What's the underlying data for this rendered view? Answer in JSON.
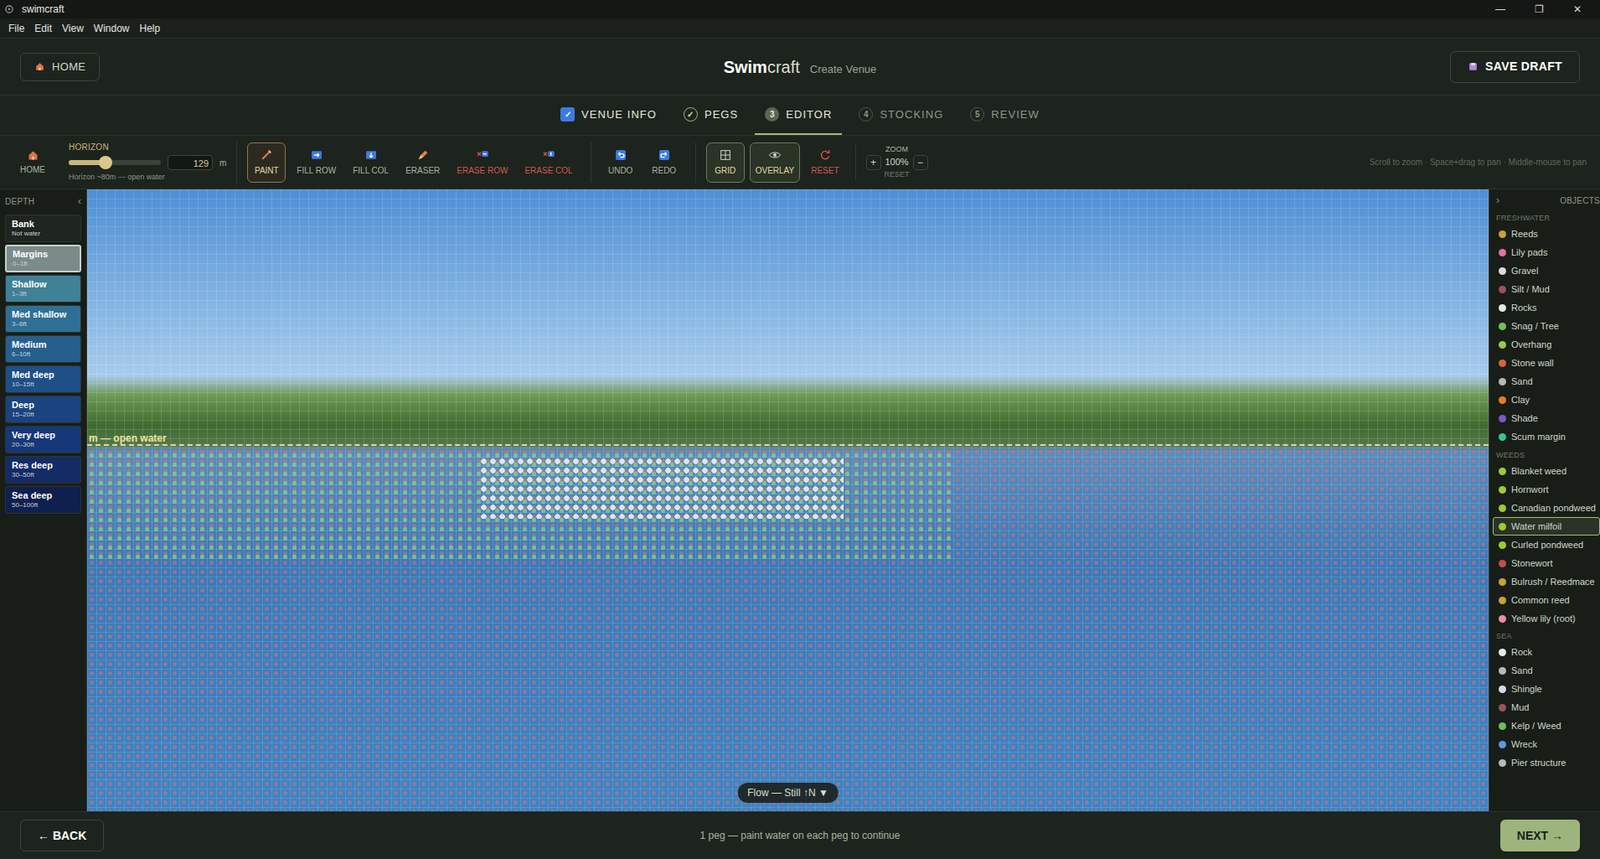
{
  "window": {
    "title": "swimcraft",
    "controls": [
      "—",
      "❐",
      "✕"
    ]
  },
  "menu": [
    "File",
    "Edit",
    "View",
    "Window",
    "Help"
  ],
  "header": {
    "home": "HOME",
    "logo_a": "Swim",
    "logo_b": "craft",
    "subtitle": "Create Venue",
    "save": "SAVE DRAFT"
  },
  "steps": [
    {
      "number": "✓",
      "label": "VENUE INFO",
      "selected": false,
      "done": true
    },
    {
      "number": "✓",
      "label": "PEGS",
      "selected": false,
      "done": true
    },
    {
      "number": "3",
      "label": "EDITOR",
      "selected": true,
      "done": false
    },
    {
      "number": "4",
      "label": "STOCKING",
      "selected": false,
      "done": false
    },
    {
      "number": "5",
      "label": "REVIEW",
      "selected": false,
      "done": false
    }
  ],
  "toolbar": {
    "home": "HOME",
    "horizon": {
      "label": "HORIZON",
      "level": 0.4,
      "value": "129",
      "unit": "m",
      "caption": "Horizon ~80m — open water"
    },
    "tools": [
      {
        "label": "PAINT",
        "kind": "tool",
        "selected": true
      },
      {
        "label": "FILL ROW",
        "kind": "tool",
        "selected": false
      },
      {
        "label": "FILL COL",
        "kind": "tool",
        "selected": false
      },
      {
        "label": "ERASER",
        "kind": "tool",
        "selected": false
      },
      {
        "label": "ERASE ROW",
        "kind": "danger",
        "selected": false
      },
      {
        "label": "ERASE COL",
        "kind": "danger",
        "selected": false
      },
      {
        "label": "UNDO",
        "kind": "history",
        "selected": false
      },
      {
        "label": "REDO",
        "kind": "history",
        "selected": false
      },
      {
        "label": "GRID",
        "kind": "toggle",
        "selected": true
      },
      {
        "label": "OVERLAY",
        "kind": "toggle",
        "selected": true
      },
      {
        "label": "RESET",
        "kind": "danger",
        "selected": false
      }
    ],
    "zoom": {
      "label": "ZOOM",
      "plus": "+",
      "value": "100%",
      "minus": "−",
      "reset": "RESET"
    },
    "hint": "Scroll to zoom · Space+drag to pan · Middle-mouse to pan"
  },
  "depth": {
    "title": "DEPTH",
    "collapse": "‹",
    "items": [
      {
        "name": "Bank",
        "range": "Not water",
        "selected": false,
        "color": "#1f251f"
      },
      {
        "name": "Margins",
        "range": "0–1ft",
        "selected": true,
        "color": "#7b8b8a"
      },
      {
        "name": "Shallow",
        "range": "1–3ft",
        "selected": false,
        "color": "#3f8196"
      },
      {
        "name": "Med shallow",
        "range": "3–6ft",
        "selected": false,
        "color": "#2f6f95"
      },
      {
        "name": "Medium",
        "range": "6–10ft",
        "selected": false,
        "color": "#255f8e"
      },
      {
        "name": "Med deep",
        "range": "10–15ft",
        "selected": false,
        "color": "#1e4f87"
      },
      {
        "name": "Deep",
        "range": "15–20ft",
        "selected": false,
        "color": "#1a4380"
      },
      {
        "name": "Very deep",
        "range": "20–30ft",
        "selected": false,
        "color": "#163878"
      },
      {
        "name": "Res deep",
        "range": "30–50ft",
        "selected": false,
        "color": "#132c66"
      },
      {
        "name": "Sea deep",
        "range": "50–100ft",
        "selected": false,
        "color": "#0f1f4e"
      }
    ]
  },
  "canvas": {
    "horizon_label": "m — open water",
    "flow": "Flow — Still ↑N ▼"
  },
  "objects": {
    "title": "OBJECTS",
    "collapse": "›",
    "groups": [
      {
        "title": "FRESHWATER",
        "items": [
          {
            "label": "Reeds",
            "selected": false,
            "color": "#c8a23a"
          },
          {
            "label": "Lily pads",
            "selected": false,
            "color": "#e26fa6"
          },
          {
            "label": "Gravel",
            "selected": false,
            "color": "#d9d9e0"
          },
          {
            "label": "Silt / Mud",
            "selected": false,
            "color": "#a0525a"
          },
          {
            "label": "Rocks",
            "selected": false,
            "color": "#e8e8e8"
          },
          {
            "label": "Snag / Tree",
            "selected": false,
            "color": "#6fbf5a"
          },
          {
            "label": "Overhang",
            "selected": false,
            "color": "#8fcf4a"
          },
          {
            "label": "Stone wall",
            "selected": false,
            "color": "#e0603a"
          },
          {
            "label": "Sand",
            "selected": false,
            "color": "#b8b8b8"
          },
          {
            "label": "Clay",
            "selected": false,
            "color": "#e87a30"
          },
          {
            "label": "Shade",
            "selected": false,
            "color": "#7a5ac8"
          },
          {
            "label": "Scum margin",
            "selected": false,
            "color": "#3ac88a"
          }
        ]
      },
      {
        "title": "WEEDS",
        "items": [
          {
            "label": "Blanket weed",
            "selected": false,
            "color": "#9acd32"
          },
          {
            "label": "Hornwort",
            "selected": false,
            "color": "#9acd32"
          },
          {
            "label": "Canadian pondweed",
            "selected": false,
            "color": "#9acd32"
          },
          {
            "label": "Water milfoil",
            "selected": true,
            "color": "#9acd32"
          },
          {
            "label": "Curled pondweed",
            "selected": false,
            "color": "#9acd32"
          },
          {
            "label": "Stonewort",
            "selected": false,
            "color": "#c0504a"
          },
          {
            "label": "Bulrush / Reedmace",
            "selected": false,
            "color": "#c8a23a"
          },
          {
            "label": "Common reed",
            "selected": false,
            "color": "#c8a23a"
          },
          {
            "label": "Yellow lily (root)",
            "selected": false,
            "color": "#f08aa0"
          }
        ]
      },
      {
        "title": "SEA",
        "items": [
          {
            "label": "Rock",
            "selected": false,
            "color": "#e8e8e8"
          },
          {
            "label": "Sand",
            "selected": false,
            "color": "#b8b8b8"
          },
          {
            "label": "Shingle",
            "selected": false,
            "color": "#dcd4f0"
          },
          {
            "label": "Mud",
            "selected": false,
            "color": "#a0525a"
          },
          {
            "label": "Kelp / Weed",
            "selected": false,
            "color": "#6fbf5a"
          },
          {
            "label": "Wreck",
            "selected": false,
            "color": "#5a9ae0"
          },
          {
            "label": "Pier structure",
            "selected": false,
            "color": "#b8b8b8"
          }
        ]
      }
    ]
  },
  "footer": {
    "back": "← BACK",
    "status": "1 peg — paint water on each peg to continue",
    "next": "NEXT →"
  }
}
